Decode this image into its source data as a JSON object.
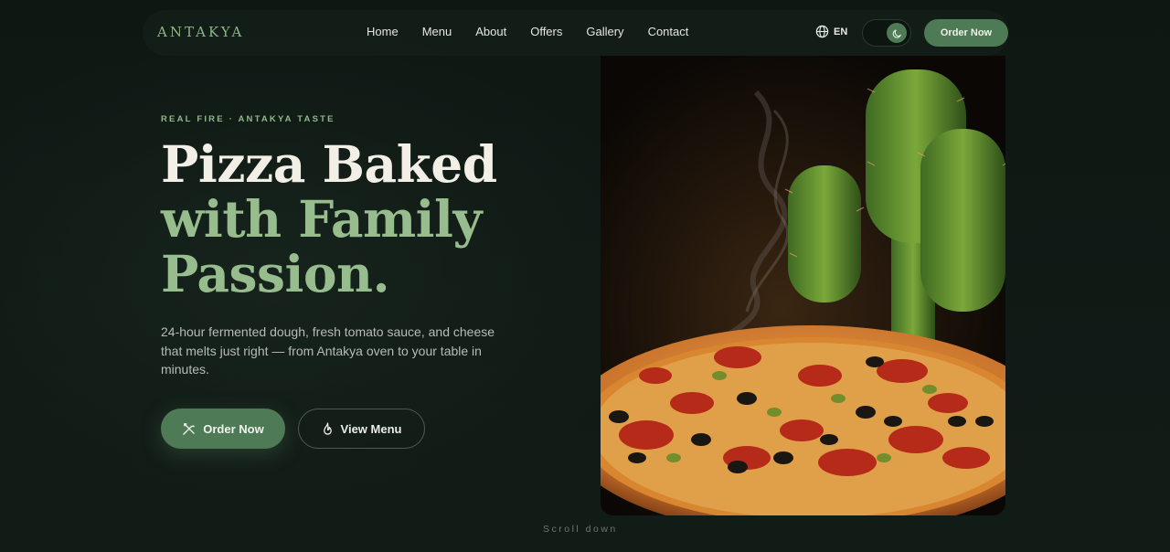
{
  "brand": {
    "name": "ANTAKYA"
  },
  "nav": {
    "links": [
      "Home",
      "Menu",
      "About",
      "Offers",
      "Gallery",
      "Contact"
    ],
    "language": "EN",
    "order_label": "Order Now"
  },
  "hero": {
    "eyebrow": "REAL FIRE · ANTAKYA TASTE",
    "headline_line1": "Pizza Baked",
    "headline_line2": "with Family",
    "headline_line3": "Passion.",
    "description": "24-hour fermented dough, fresh tomato sauce, and cheese that melts just right — from Antakya oven to your table in minutes.",
    "primary_button": "Order Now",
    "secondary_button": "View Menu",
    "scroll_hint": "Scroll down"
  },
  "colors": {
    "background": "#111a15",
    "accent": "#4f7a56",
    "accent_text": "#97bd8f"
  }
}
